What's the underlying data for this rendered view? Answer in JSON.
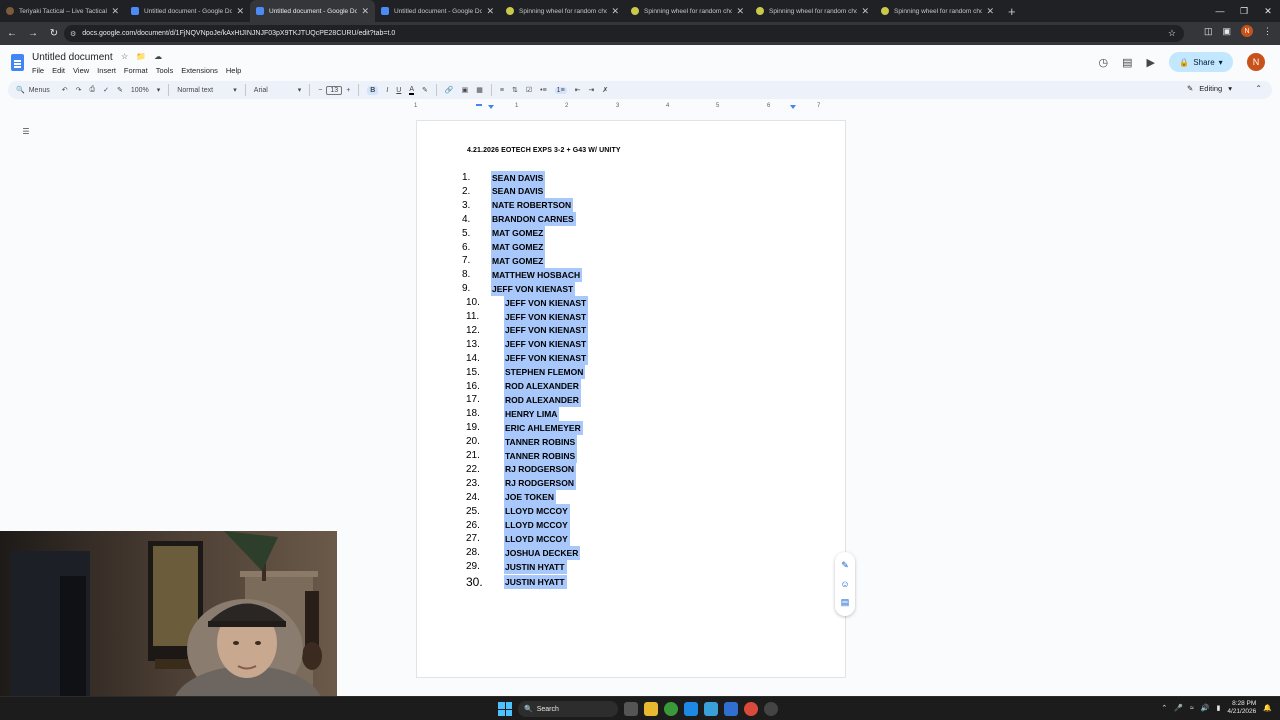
{
  "browser": {
    "tabs": [
      {
        "title": "Teriyaki Tactical – Live Tactical We...",
        "icon": "teriyaki-favicon",
        "active": false
      },
      {
        "title": "Untitled document - Google Docs",
        "icon": "docs-favicon",
        "active": false
      },
      {
        "title": "Untitled document - Google Docs",
        "icon": "docs-favicon",
        "active": true
      },
      {
        "title": "Untitled document - Google Docs",
        "icon": "docs-favicon",
        "active": false
      },
      {
        "title": "Spinning wheel for random choic...",
        "icon": "wheel-favicon",
        "active": false
      },
      {
        "title": "Spinning wheel for random choic...",
        "icon": "wheel-favicon",
        "active": false
      },
      {
        "title": "Spinning wheel for random choic...",
        "icon": "wheel-favicon",
        "active": false
      },
      {
        "title": "Spinning wheel for random choic...",
        "icon": "wheel-favicon",
        "active": false
      }
    ],
    "url": "docs.google.com/document/d/1FjNQVNpoJe/kAxHtJINJNJF03pX9TKJTUQcPE28CURU/edit?tab=t.0",
    "profile_initial": "N"
  },
  "docs": {
    "title": "Untitled document",
    "menu": [
      "File",
      "Edit",
      "View",
      "Insert",
      "Format",
      "Tools",
      "Extensions",
      "Help"
    ],
    "share_label": "Share",
    "avatar_initial": "N",
    "toolbar": {
      "menus_label": "Menus",
      "zoom": "100%",
      "style": "Normal text",
      "font": "Arial",
      "font_size": "13",
      "mode": "Editing"
    },
    "ruler_numbers": [
      "1",
      "1",
      "2",
      "3",
      "4",
      "5",
      "6",
      "7"
    ]
  },
  "document": {
    "heading": "4.21.2026 EOTECH EXPS 3-2 + G43 W/ UNITY",
    "list": [
      "SEAN DAVIS",
      "SEAN DAVIS",
      "NATE ROBERTSON",
      "BRANDON CARNES",
      "MAT GOMEZ",
      "MAT GOMEZ",
      "MAT GOMEZ",
      "MATTHEW HOSBACH",
      "JEFF VON KIENAST",
      "JEFF VON KIENAST",
      "JEFF VON KIENAST",
      "JEFF VON KIENAST",
      "JEFF VON KIENAST",
      "JEFF VON KIENAST",
      "STEPHEN FLEMON",
      "ROD ALEXANDER",
      "ROD ALEXANDER",
      "HENRY LIMA",
      "ERIC AHLEMEYER",
      "TANNER ROBINS",
      "TANNER ROBINS",
      "RJ RODGERSON",
      "RJ RODGERSON",
      "JOE TOKEN",
      "LLOYD MCCOY",
      "LLOYD MCCOY",
      "LLOYD MCCOY",
      "JOSHUA DECKER",
      "JUSTIN HYATT",
      "JUSTIN HYATT"
    ],
    "selection_color": "#a8c7fa"
  },
  "taskbar": {
    "search_label": "Search",
    "time": "8:28 PM",
    "date": "4/21/2026"
  }
}
